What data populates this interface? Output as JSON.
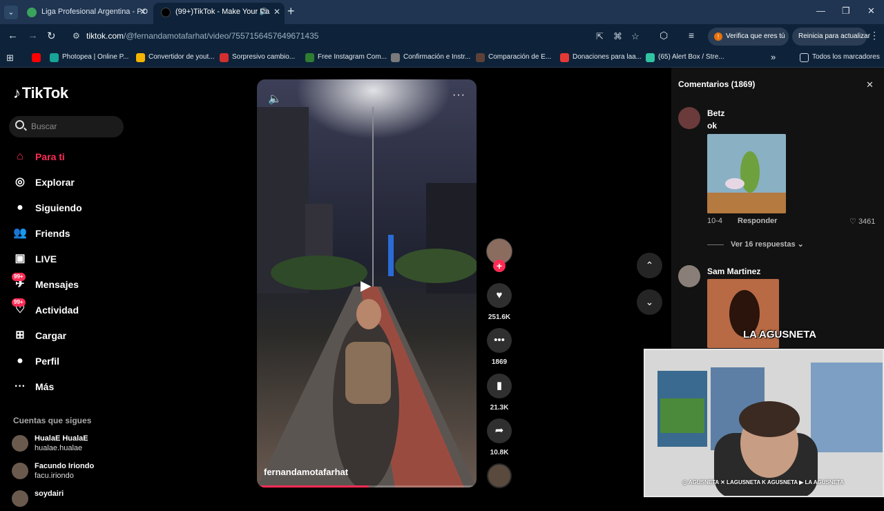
{
  "browser": {
    "tabs": [
      {
        "title": "Liga Profesional Argentina - PO",
        "active": false,
        "favicon_color": "#3aa35c"
      },
      {
        "title": "(99+)TikTok - Make Your Da",
        "active": true,
        "favicon_color": "#000000"
      }
    ],
    "tab_menu_icon": "chevron-down",
    "new_tab_label": "+",
    "window_controls": {
      "minimize": "—",
      "restore": "❐",
      "close": "✕"
    },
    "url_host": "tiktok.com",
    "url_path": "/@fernandamotafarhat/video/7557156457649671435",
    "verify_label": "Verifica que eres tú",
    "relaunch_label": "Reinicia para actualizar",
    "bookmarks": [
      {
        "label": "",
        "color": "#ff0000"
      },
      {
        "label": "Photopea | Online P...",
        "color": "#18a497"
      },
      {
        "label": "Convertidor de yout...",
        "color": "#f4b400"
      },
      {
        "label": "Sorpresivo cambio...",
        "color": "#d32f2f"
      },
      {
        "label": "Free Instagram Com...",
        "color": "#2e7d32"
      },
      {
        "label": "Confirmación e Instr...",
        "color": "#7a7a7a"
      },
      {
        "label": "Comparación de E...",
        "color": "#5d4037"
      },
      {
        "label": "Donaciones para laa...",
        "color": "#e53935"
      },
      {
        "label": "(65) Alert Box / Stre...",
        "color": "#31c3a2"
      }
    ],
    "bookmarks_overflow": "»",
    "all_bookmarks_label": "Todos los marcadores"
  },
  "sidebar": {
    "logo_text": "TikTok",
    "search_placeholder": "Buscar",
    "nav": [
      {
        "label": "Para ti",
        "icon": "home-icon",
        "glyph": "⌂",
        "active": true
      },
      {
        "label": "Explorar",
        "icon": "compass-icon",
        "glyph": "◎",
        "active": false
      },
      {
        "label": "Siguiendo",
        "icon": "following-avatar-icon",
        "glyph": "●",
        "active": false
      },
      {
        "label": "Friends",
        "icon": "friends-icon",
        "glyph": "👥",
        "active": false
      },
      {
        "label": "LIVE",
        "icon": "live-icon",
        "glyph": "▣",
        "active": false
      },
      {
        "label": "Mensajes",
        "icon": "messages-icon",
        "glyph": "✈",
        "active": false,
        "badge": "99+"
      },
      {
        "label": "Actividad",
        "icon": "activity-icon",
        "glyph": "♡",
        "active": false,
        "badge": "99+"
      },
      {
        "label": "Cargar",
        "icon": "upload-icon",
        "glyph": "⊞",
        "active": false
      },
      {
        "label": "Perfil",
        "icon": "profile-avatar-icon",
        "glyph": "●",
        "active": false
      },
      {
        "label": "Más",
        "icon": "more-dots-icon",
        "glyph": "···",
        "active": false
      }
    ],
    "following_title": "Cuentas que sigues",
    "following": [
      {
        "display": "HualaE HualaE",
        "handle": "hualae.hualae"
      },
      {
        "display": "Facundo Iriondo",
        "handle": "facu.iriondo"
      },
      {
        "display": "soydairi",
        "handle": ""
      }
    ]
  },
  "video": {
    "username": "fernandamotafarhat",
    "progress": 0.51
  },
  "actions": {
    "likes": "251.6K",
    "comments": "1869",
    "saves": "21.3K",
    "shares": "10.8K"
  },
  "comments_panel": {
    "title": "Comentarios (1869)",
    "items": [
      {
        "author": "Betz",
        "text": "ok",
        "date": "10-4",
        "reply_label": "Responder",
        "likes": "3461",
        "view_replies": "Ver 16 respuestas"
      },
      {
        "author": "Sam Martinez",
        "text": "",
        "date": "",
        "reply_label": "",
        "likes": "",
        "view_replies": ""
      }
    ]
  },
  "stream_overlay": {
    "brand": "LA AGUSNETA",
    "socials": "◎ AGUSNETA  ✕ LAGUSNETA  K AGUSNETA  ▶ LA AGUSNETA"
  }
}
